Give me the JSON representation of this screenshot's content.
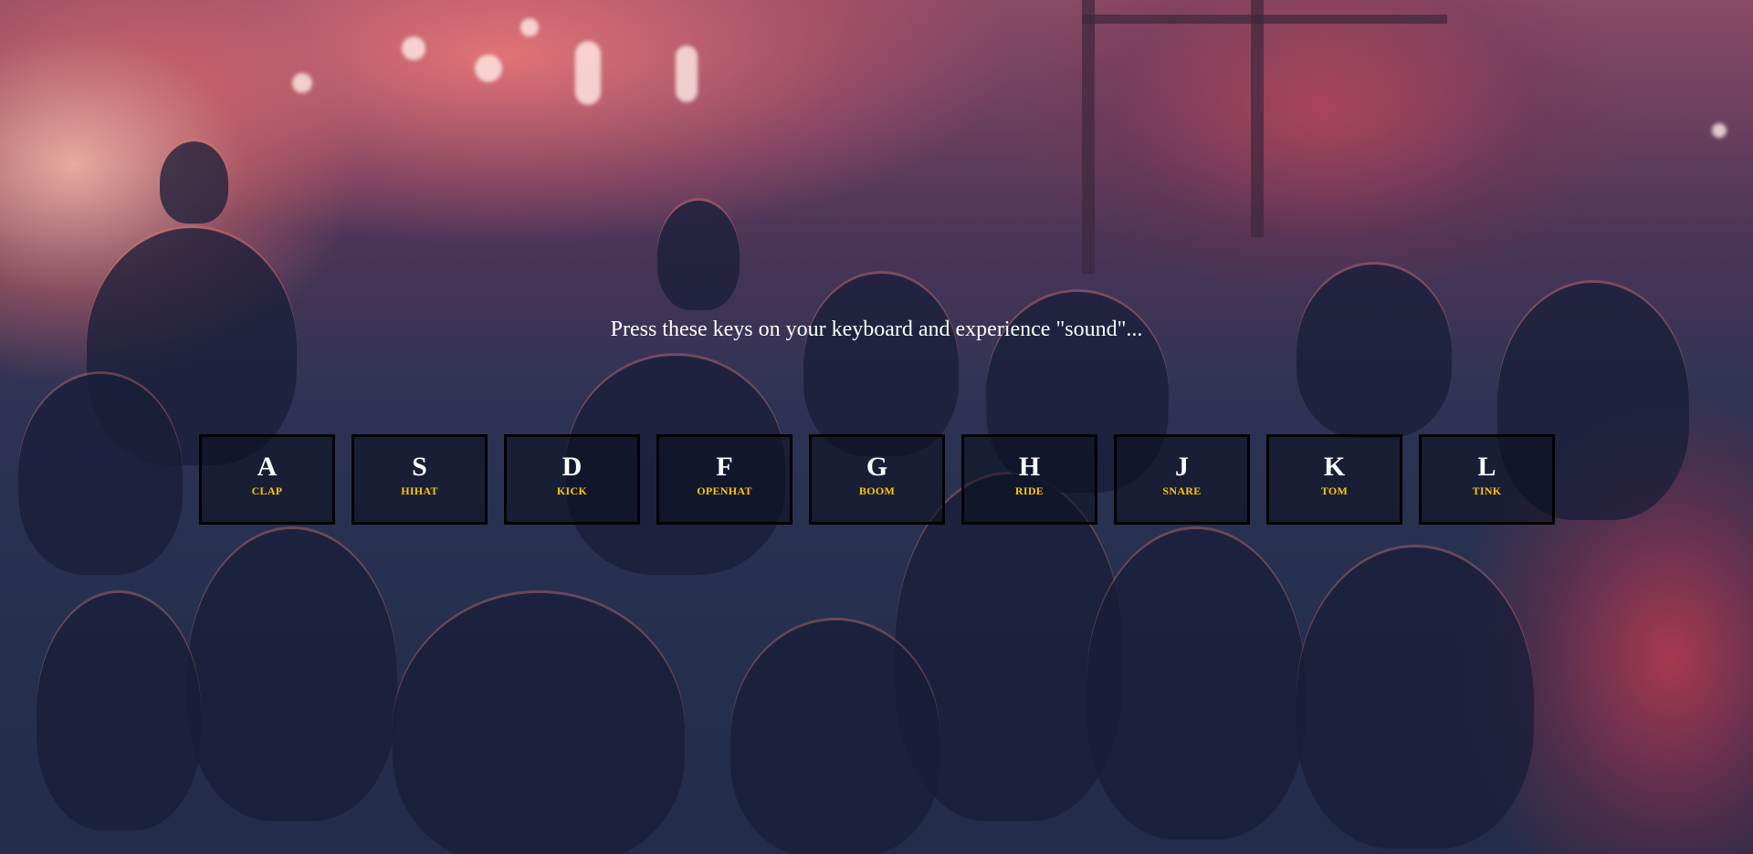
{
  "page": {
    "prompt": "Press these keys on your keyboard and experience \"sound\"..."
  },
  "keys": [
    {
      "key": "A",
      "sound": "CLAP"
    },
    {
      "key": "S",
      "sound": "HIHAT"
    },
    {
      "key": "D",
      "sound": "KICK"
    },
    {
      "key": "F",
      "sound": "OPENHAT"
    },
    {
      "key": "G",
      "sound": "BOOM"
    },
    {
      "key": "H",
      "sound": "RIDE"
    },
    {
      "key": "J",
      "sound": "SNARE"
    },
    {
      "key": "K",
      "sound": "TOM"
    },
    {
      "key": "L",
      "sound": "TINK"
    }
  ],
  "colors": {
    "sound_label": "#ffc600",
    "key_letter": "#ffffff",
    "key_border": "#000000"
  }
}
